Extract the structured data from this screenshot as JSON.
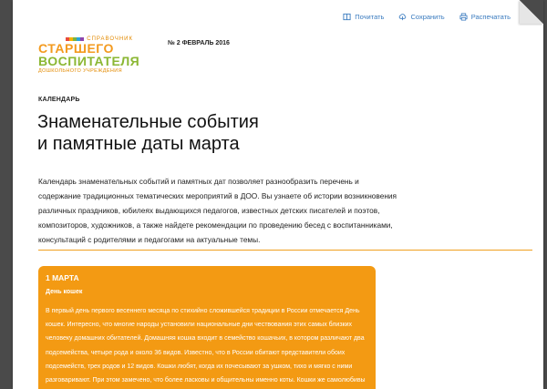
{
  "toolbar": {
    "read_label": "Почитать",
    "save_label": "Сохранить",
    "print_label": "Распечатать"
  },
  "logo": {
    "top": "СПРАВОЧНИК",
    "line1": "СТАРШЕГО",
    "line2": "ВОСПИТАТЕЛЯ",
    "bottom": "ДОШКОЛЬНОГО УЧРЕЖДЕНИЯ"
  },
  "issue": "№ 2 ФЕВРАЛЬ 2016",
  "section": "КАЛЕНДАРЬ",
  "title": {
    "line1": "Знаменательные события",
    "line2": "и памятные даты марта"
  },
  "lead": "Календарь знаменательных событий и памятных дат позволяет разнообразить перечень и содержание традиционных тематических мероприятий в ДОО. Вы узнаете об истории возникновения различных праздников, юбилеях выдающихся педагогов, известных детских писателей и поэтов, композиторов, художников, а также найдете рекомендации по проведению бесед с воспитанниками, консультаций с родителями и педагогами на актуальные темы.",
  "card": {
    "date": "1 МАРТА",
    "heading": "День кошек",
    "text": "В первый день первого весеннего месяца по стихийно сложившейся традиции в России отмечается День кошек. Интересно, что многие народы установили национальные дни чествования этих самых близких человеку домашних обитателей. Домашняя кошка входит в семейство кошачьих, в котором различают два подсемейства, четыре рода и около 36 видов. Известно, что в России обитают представители обоих подсемейств, трех родов и 12 видов. Кошки любят, когда их почесывают за ушком, тихо и мягко с ними разговаривают. При этом замечено, что более ласковы и общительны именно коты. Кошки же самолюбивы и капризны."
  },
  "colors": {
    "accent_orange": "#f39a13",
    "link_blue": "#3a7bbf",
    "logo_green": "#8bb733"
  }
}
